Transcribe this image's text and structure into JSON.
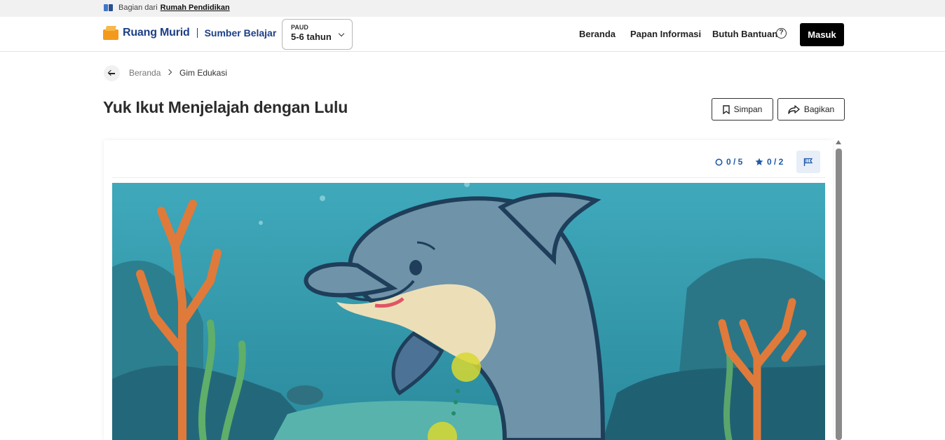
{
  "topbar": {
    "prefix": "Bagian dari",
    "link": "Rumah Pendidikan"
  },
  "header": {
    "brand": "Ruang Murid",
    "section": "Sumber Belajar",
    "level_small": "PAUD",
    "level_value": "5-6 tahun",
    "nav": [
      "Beranda",
      "Papan Informasi",
      "Butuh Bantuan"
    ],
    "login": "Masuk"
  },
  "breadcrumb": {
    "home": "Beranda",
    "current": "Gim Edukasi"
  },
  "page": {
    "title": "Yuk Ikut Menjelajah dengan Lulu",
    "save": "Simpan",
    "share": "Bagikan"
  },
  "game": {
    "progress": "0 / 5",
    "stars": "0 / 2",
    "colors": {
      "accent": "#1f5aa8",
      "water": "#2b8fa3",
      "coral": "#e07a3a",
      "dolphin": "#6f93a8",
      "marker": "#d8d830"
    }
  }
}
